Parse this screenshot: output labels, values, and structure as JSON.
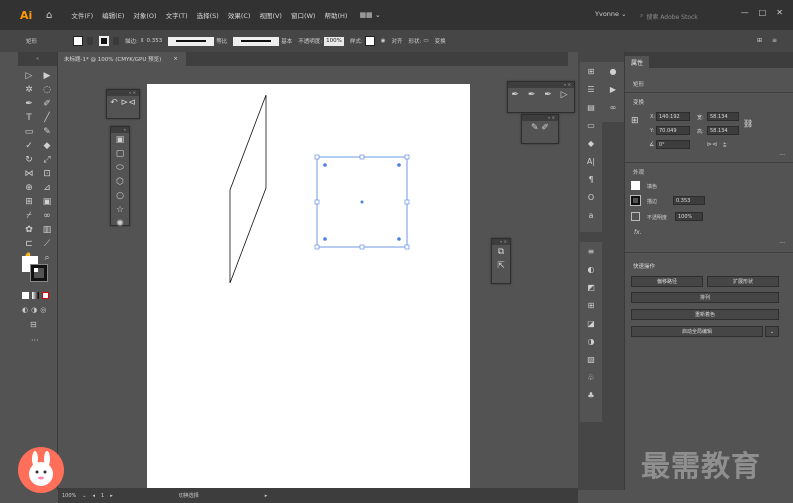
{
  "app": {
    "logo": "Ai",
    "menus": [
      "文件(F)",
      "编辑(E)",
      "对象(O)",
      "文字(T)",
      "选择(S)",
      "效果(C)",
      "视图(V)",
      "窗口(W)",
      "帮助(H)"
    ],
    "user": "Yvonne",
    "search_placeholder": "搜索 Adobe Stock"
  },
  "control_bar": {
    "selection_label": "矩形",
    "stroke_weight_label": "描边:",
    "stroke_weight_value": "0.353",
    "stroke_profile": "等比",
    "brush": "基本",
    "opacity_label": "不透明度:",
    "opacity_value": "100%",
    "style_label": "样式:",
    "align_label": "对齐",
    "shape_label": "形状:",
    "transform_label": "变换"
  },
  "document": {
    "tab_title": "未标题-1* @ 100% (CMYK/GPU 预览)",
    "close_glyph": "×"
  },
  "properties": {
    "tab": "属性",
    "selection_type": "矩形",
    "transform_label": "变换",
    "x_label": "X:",
    "x_value": "140.192",
    "y_label": "Y:",
    "y_value": "70.049",
    "w_label": "宽:",
    "w_value": "58.134",
    "h_label": "高:",
    "h_value": "58.134",
    "angle_value": "0°",
    "appearance_label": "外观",
    "fill_label": "填色",
    "stroke_label": "描边",
    "stroke_value": "0.353",
    "opacity_label": "不透明度",
    "opacity_value": "100%",
    "fx_label": "fx.",
    "quick_actions_label": "快速操作",
    "btn_offset_path": "偏移路径",
    "btn_expand_shape": "扩展形状",
    "btn_arrange": "排列",
    "btn_recolor": "重新着色",
    "btn_global_edit": "启动全局编辑"
  },
  "statusbar": {
    "zoom": "100%",
    "artboard": "1",
    "tool_name": "切换选择"
  },
  "watermark": "最需教育",
  "colors": {
    "menubar": "#323232",
    "panel": "#535353",
    "selection_blue": "#4d7fe0",
    "accent_orange": "#ff9a00"
  }
}
